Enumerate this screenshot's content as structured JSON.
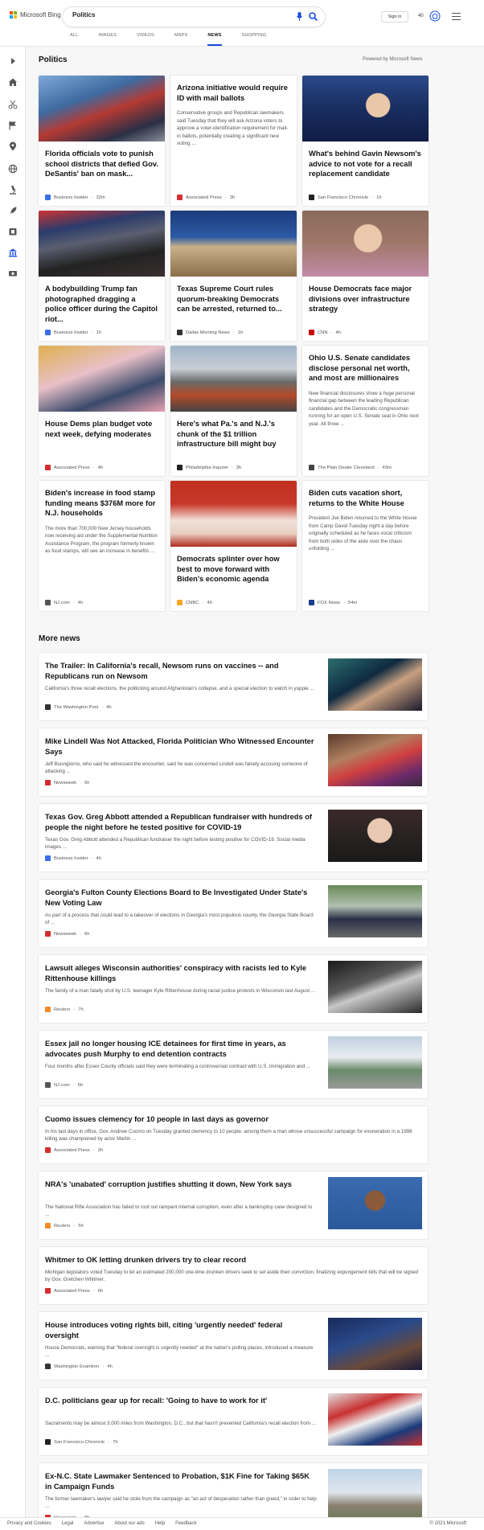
{
  "brand": {
    "name": "Microsoft Bing",
    "colors": [
      "#f25022",
      "#7fba00",
      "#00a4ef",
      "#ffb900"
    ]
  },
  "search": {
    "query": "Politics"
  },
  "scopes": [
    "ALL",
    "IMAGES",
    "VIDEOS",
    "MAPS",
    "NEWS",
    "SHOPPING"
  ],
  "header": {
    "signin": "Sign in",
    "points": "40"
  },
  "sidebar": {
    "icons": [
      "expand-arrow-icon",
      "home-icon",
      "scissors-icon",
      "flag-icon",
      "location-pin-icon",
      "globe-icon",
      "microscope-icon",
      "rocket-icon",
      "film-icon",
      "bank-icon",
      "money-icon"
    ]
  },
  "topic": {
    "title": "Politics",
    "powered_by": "Powered by Microsoft News"
  },
  "cards": [
    {
      "title": "Florida officials vote to punish school districts that defied Gov. DeSantis' ban on mask...",
      "snippet": "",
      "source": "Business Insider",
      "time": "32m",
      "fav_color": "#3a6fe8",
      "image": "masked-students-photo"
    },
    {
      "title": "Arizona initiative would require ID with mail ballots",
      "snippet": "Conservative groups and Republican lawmakers said Tuesday that they will ask Arizona voters to approve a voter-identification requirement for mail-in ballots, potentially creating a significant new voting ...",
      "source": "Associated Press",
      "time": "3h",
      "fav_color": "#d32f2f",
      "image": ""
    },
    {
      "title": "What's behind Gavin Newsom's advice to not vote for a recall replacement candidate",
      "snippet": "",
      "source": "San Francisco Chronicle",
      "time": "1h",
      "fav_color": "#222222",
      "image": "newsom-photo"
    },
    {
      "title": "A bodybuilding Trump fan photographed dragging a police officer during the Capitol riot...",
      "snippet": "",
      "source": "Business Insider",
      "time": "1h",
      "fav_color": "#3a6fe8",
      "image": "capitol-riot-photo"
    },
    {
      "title": "Texas Supreme Court rules quorum-breaking Democrats can be arrested, returned to...",
      "snippet": "",
      "source": "Dallas Morning News",
      "time": "1h",
      "fav_color": "#333333",
      "image": "texas-capitol-photo"
    },
    {
      "title": "House Democrats face major divisions over infrastructure strategy",
      "snippet": "",
      "source": "CNN",
      "time": "4h",
      "fav_color": "#cc0000",
      "image": "pelosi-photo"
    },
    {
      "title": "House Dems plan budget vote next week, defying moderates",
      "snippet": "",
      "source": "Associated Press",
      "time": "4h",
      "fav_color": "#d32f2f",
      "image": "pelosi-podium-photo"
    },
    {
      "title": "Here's what Pa.'s and N.J.'s chunk of the $1 trillion infrastructure bill might buy",
      "snippet": "",
      "source": "Philadelphia Inquirer",
      "time": "3h",
      "fav_color": "#222222",
      "image": "highway-photo"
    },
    {
      "title": "Ohio U.S. Senate candidates disclose personal net worth, and most are millionaires",
      "snippet": "New financial disclosures show a huge personal financial gap between the leading Republican candidates and the Democratic congressman running for an open U.S. Senate seat in Ohio next year. All three ...",
      "source": "The Plain Dealer Cleveland",
      "time": "43m",
      "fav_color": "#444444",
      "image": ""
    },
    {
      "title": "Biden's increase in food stamp funding means $376M more for N.J. households",
      "snippet": "The more than 700,000 New Jersey households now receiving aid under the Supplemental Nutrition Assistance Program, the program formerly known as food stamps, will see an increase in benefits ...",
      "source": "NJ.com",
      "time": "4h",
      "fav_color": "#555555",
      "image": ""
    },
    {
      "title": "Democrats splinter over how best to move forward with Biden's economic agenda",
      "snippet": "",
      "source": "CNBC",
      "time": "4h",
      "fav_color": "#f5a623",
      "image": "pelosi-speaking-photo"
    },
    {
      "title": "Biden cuts vacation short, returns to the White House",
      "snippet": "President Joe Biden returned to the White House from Camp David Tuesday night a day before originally scheduled as he faces vocal criticism from both sides of the aisle over the chaos unfolding ...",
      "source": "FOX News",
      "time": "54m",
      "fav_color": "#1a3d8f",
      "image": ""
    }
  ],
  "more_news": {
    "title": "More news",
    "items": [
      {
        "title": "The Trailer: In California's recall, Newsom runs on vaccines -- and Republicans run on Newsom",
        "snippet": "California's three recall elections, the politicking around Afghanistan's collapse, and a special election to watch in yuppie ...",
        "source": "The Washington Post",
        "time": "4h",
        "fav_color": "#333333",
        "image": "newsom-crowd-photo"
      },
      {
        "title": "Mike Lindell Was Not Attacked, Florida Politician Who Witnessed Encounter Says",
        "snippet": "Jeff Buongiorno, who said he witnessed the encounter, said he was concerned Lindell was falsely accusing someone of attacking ...",
        "source": "Newsweek",
        "time": "5h",
        "fav_color": "#d32f2f",
        "image": "lindell-photo"
      },
      {
        "title": "Texas Gov. Greg Abbott attended a Republican fundraiser with hundreds of people the night before he tested positive for COVID-19",
        "snippet": "Texas Gov. Greg Abbott attended a Republican fundraiser the night before testing positive for COVID-19. Social media images ...",
        "source": "Business Insider",
        "time": "4h",
        "fav_color": "#3a6fe8",
        "image": "abbott-photo"
      },
      {
        "title": "Georgia's Fulton County Elections Board to Be Investigated Under State's New Voting Law",
        "snippet": "As part of a process that could lead to a takeover of elections in Georgia's most populous county, the Georgia State Board of ...",
        "source": "Newsweek",
        "time": "6h",
        "fav_color": "#d32f2f",
        "image": "georgia-officials-photo"
      },
      {
        "title": "Lawsuit alleges Wisconsin authorities' conspiracy with racists led to Kyle Rittenhouse killings",
        "snippet": "The family of a man fatally shot by U.S. teenager Kyle Rittenhouse during racial justice protests in Wisconsin last August ...",
        "source": "Reuters",
        "time": "7h",
        "fav_color": "#f08c28",
        "image": "protest-smoke-photo"
      },
      {
        "title": "Essex jail no longer housing ICE detainees for first time in years, as advocates push Murphy to end detention contracts",
        "snippet": "Four months after Essex County officials said they were terminating a controversial contract with U.S. Immigration and ...",
        "source": "NJ.com",
        "time": "5h",
        "fav_color": "#555555",
        "image": "jail-building-photo"
      },
      {
        "title": "Cuomo issues clemency for 10 people in last days as governor",
        "snippet": "In his last days in office, Gov. Andrew Cuomo on Tuesday granted clemency to 10 people, among them a man whose unsuccessful campaign for exoneration in a 1998 killing was championed by actor Martin ...",
        "source": "Associated Press",
        "time": "2h",
        "fav_color": "#d32f2f",
        "image": ""
      },
      {
        "title": "NRA's 'unabated' corruption justifies shutting it down, New York says",
        "snippet": "The National Rifle Association has failed to root out rampant internal corruption, even after a bankruptcy case designed to ...",
        "source": "Reuters",
        "time": "5h",
        "fav_color": "#f08c28",
        "image": "nra-woman-photo"
      },
      {
        "title": "Whitmer to OK letting drunken drivers try to clear record",
        "snippet": "Michigan legislators voted Tuesday to let an estimated 200,000 one-time drunken drivers seek to set aside their conviction, finalizing expungement bills that will be signed by Gov. Gretchen Whitmer.",
        "source": "Associated Press",
        "time": "6h",
        "fav_color": "#d32f2f",
        "image": ""
      },
      {
        "title": "House introduces voting rights bill, citing 'urgently needed' federal oversight",
        "snippet": "House Democrats, warning that \"federal oversight is urgently needed\" at the nation's polling places, introduced a measure ...",
        "source": "Washington Examiner",
        "time": "4h",
        "fav_color": "#333333",
        "image": "voting-rally-photo"
      },
      {
        "title": "D.C. politicians gear up for recall: 'Going to have to work for it'",
        "snippet": "Sacramento may be almost 3,000 miles from Washington, D.C., but that hasn't prevented California's recall election from ...",
        "source": "San Francisco Chronicle",
        "time": "7h",
        "fav_color": "#222222",
        "image": "recall-signs-photo"
      },
      {
        "title": "Ex-N.C. State Lawmaker Sentenced to Probation, $1K Fine for Taking $65K in Campaign Funds",
        "snippet": "The former lawmaker's lawyer said he stole from the campaign as \"an act of desperation rather than greed,\" in order to help ...",
        "source": "Newsweek",
        "time": "8h",
        "fav_color": "#d32f2f",
        "image": "nc-capitol-photo"
      }
    ]
  },
  "footer": {
    "links": [
      "Privacy and Cookies",
      "Legal",
      "Advertise",
      "About our ads",
      "Help",
      "Feedback"
    ],
    "copyright": "© 2021 Microsoft"
  }
}
